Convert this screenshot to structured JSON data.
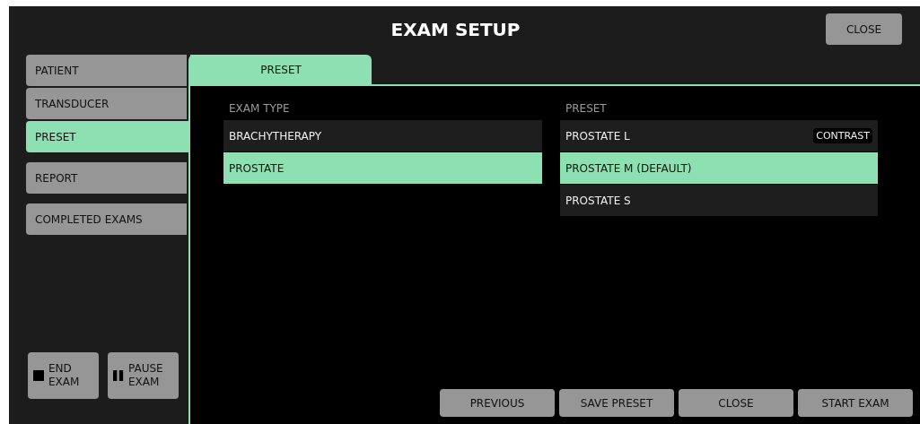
{
  "window": {
    "title": "EXAM SETUP",
    "close_button": "CLOSE"
  },
  "sidebar": {
    "items": [
      {
        "label": "PATIENT",
        "selected": false
      },
      {
        "label": "TRANSDUCER",
        "selected": false
      },
      {
        "label": "PRESET",
        "selected": true
      },
      {
        "label": "REPORT",
        "selected": false
      },
      {
        "label": "COMPLETED EXAMS",
        "selected": false
      }
    ],
    "actions": [
      {
        "kind": "stop",
        "label": "END EXAM"
      },
      {
        "kind": "pause",
        "label": "PAUSE EXAM"
      }
    ]
  },
  "tabs": [
    {
      "label": "PRESET",
      "selected": true
    }
  ],
  "exam_type": {
    "header": "EXAM TYPE",
    "items": [
      {
        "label": "BRACHYTHERAPY",
        "selected": false
      },
      {
        "label": "PROSTATE",
        "selected": true
      }
    ]
  },
  "preset": {
    "header": "PRESET",
    "items": [
      {
        "label": "PROSTATE L",
        "selected": false,
        "badge": "CONTRAST"
      },
      {
        "label": "PROSTATE M (DEFAULT)",
        "selected": true
      },
      {
        "label": "PROSTATE S",
        "selected": false
      }
    ]
  },
  "buttons": [
    "PREVIOUS",
    "SAVE PRESET",
    "CLOSE",
    "START EXAM"
  ]
}
